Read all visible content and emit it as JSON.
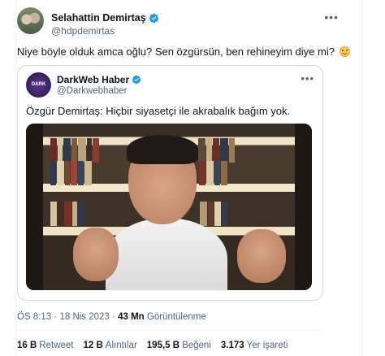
{
  "tweet": {
    "author": {
      "name": "Selahattin Demirtaş",
      "handle": "@hdpdemirtas",
      "verified": true
    },
    "text": "Niye böyle olduk amca oğlu? Sen özgürsün, ben rehineyim diye mi?",
    "emoji": "blush-emoji",
    "more_icon": "more-icon"
  },
  "quoted": {
    "author": {
      "name": "DarkWeb Haber",
      "handle": "@Darkwebhaber",
      "verified": true,
      "avatar_text": "DARK WEB"
    },
    "text": "Özgür Demirtaş: Hiçbir siyasetçi ile akrabalık bağım yok.",
    "media": "video-thumbnail"
  },
  "meta": {
    "time": "ÖS 8:13",
    "date": "18 Nis 2023",
    "views_count": "43 Mn",
    "views_label": "Görüntülenme",
    "sep": "·"
  },
  "stats": [
    {
      "count": "16 B",
      "label": "Retweet"
    },
    {
      "count": "12 B",
      "label": "Alıntılar"
    },
    {
      "count": "195,5 B",
      "label": "Beğeni"
    },
    {
      "count": "3.173",
      "label": "Yer işareti"
    }
  ],
  "colors": {
    "verified": "#1d9bf0",
    "secondary_text": "#536471",
    "border": "#cfd9de"
  }
}
